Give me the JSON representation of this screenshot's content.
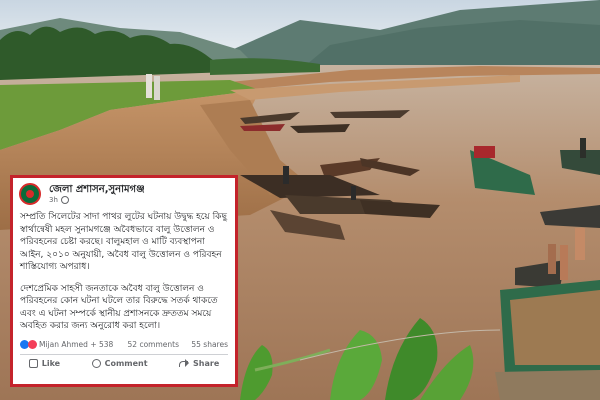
{
  "post": {
    "page_name": "জেলা প্রশাসন,সুনামগঞ্জ",
    "timestamp": "3h",
    "paragraph_1": "সম্প্রতি সিলেটের সাদা পাথর লুটের ঘটনায় উদ্বুদ্ধ হয়ে কিছু স্বার্থান্বেষী মহল সুনামগঞ্জে অবৈধভাবে বালু উত্তোলন ও পরিবহনের চেষ্টা করছে। বালুমহাল ও মাটি ব্যবস্থাপনা আইন, ২০১০ অনুযায়ী, অবৈধ বালু উত্তোলন ও পরিবহন শাস্তিযোগ্য অপরাধ।",
    "paragraph_2": "দেশপ্রেমিক সাহসী জনতাকে অবৈধ বালু উত্তোলন ও পরিবহনের কোন ঘটনা ঘটলে তার বিরুদ্ধে সতর্ক থাকতে এবং এ ঘটনা সম্পর্কে স্থানীয় প্রশাসনকে দ্রুততম সময়ে অবহিত করার জন্য অনুরোধ করা হলো।",
    "reactions_text": "Mijan Ahmed + 538",
    "comments_text": "52 comments",
    "shares_text": "55 shares",
    "actions": {
      "like": "Like",
      "comment": "Comment",
      "share": "Share"
    }
  },
  "icons": [
    "logo-icon",
    "globe-icon",
    "like-reaction-icon",
    "love-reaction-icon",
    "like-icon",
    "comment-icon",
    "share-icon"
  ],
  "colors": {
    "card_border": "#c4232b",
    "facebook_blue": "#1877f2",
    "river": "#b08a6a",
    "grass": "#6d9b3a"
  }
}
